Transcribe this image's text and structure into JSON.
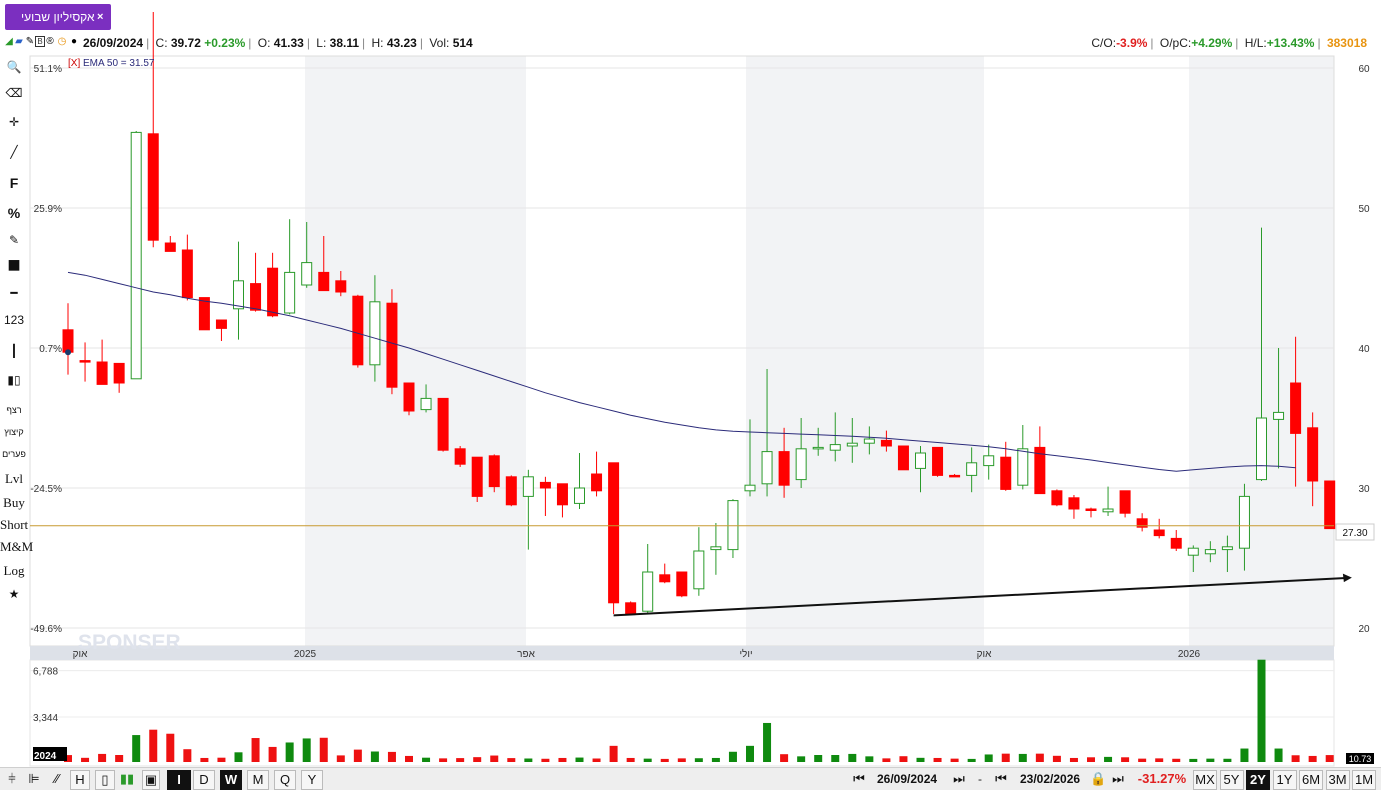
{
  "tab": {
    "title": "אקסיליון שבועי",
    "close": "×"
  },
  "info": {
    "date": "26/09/2024",
    "c_label": "C:",
    "c_value": "39.72",
    "c_change": "+0.23%",
    "o_label": "O:",
    "o_value": "41.33",
    "l_label": "L:",
    "l_value": "38.11",
    "h_label": "H:",
    "h_value": "43.23",
    "vol_label": "Vol:",
    "vol_value": "514",
    "co_label": "C/O:",
    "co_value": "-3.9%",
    "opc_label": "O/pC:",
    "opc_value": "+4.29%",
    "hl_label": "H/L:",
    "hl_value": "+13.43%",
    "symbol_id": "383018"
  },
  "toolbar_left": [
    {
      "name": "search-icon",
      "glyph": "🔍"
    },
    {
      "name": "eraser-icon",
      "glyph": "⌫"
    },
    {
      "name": "crosshair-icon",
      "glyph": "✛"
    },
    {
      "name": "line-tool-icon",
      "glyph": "╱"
    },
    {
      "name": "fibonacci-tool",
      "glyph": "F"
    },
    {
      "name": "percent-tool",
      "glyph": "%"
    },
    {
      "name": "pencil-icon",
      "glyph": "✎"
    },
    {
      "name": "color-swatch",
      "glyph": "■"
    },
    {
      "name": "line-width-icon",
      "glyph": "━"
    },
    {
      "name": "number-tool",
      "glyph": "123"
    },
    {
      "name": "vertical-line-icon",
      "glyph": "┃"
    },
    {
      "name": "candles-icon",
      "glyph": "▮▯"
    },
    {
      "name": "tool-range",
      "glyph": "רצף"
    },
    {
      "name": "tool-zoom",
      "glyph": "קיצוץ"
    },
    {
      "name": "tool-gaps",
      "glyph": "פערים"
    },
    {
      "name": "tool-lvl",
      "glyph": "Lvl"
    },
    {
      "name": "tool-buy",
      "glyph": "Buy"
    },
    {
      "name": "tool-short",
      "glyph": "Short"
    },
    {
      "name": "tool-mm",
      "glyph": "M&M"
    },
    {
      "name": "tool-log",
      "glyph": "Log"
    },
    {
      "name": "star-icon",
      "glyph": "★"
    }
  ],
  "bottom": {
    "periods": [
      "D",
      "W",
      "M",
      "Q",
      "Y"
    ],
    "active_period": "W",
    "start_date": "26/09/2024",
    "end_date": "23/02/2026",
    "dash": "-",
    "range_change": "-31.27%",
    "ranges": [
      "MX",
      "5Y",
      "2Y",
      "1Y",
      "6M",
      "3M",
      "1M"
    ],
    "active_range": "2Y",
    "year_label": "2024"
  },
  "colors": {
    "up": "#2a9a2a",
    "down": "#ff0000",
    "ema": "#2b2b7a",
    "hline": "#c79a30",
    "band": "#f2f3f5",
    "accent": "#7b2fc0"
  },
  "chart_data": {
    "type": "candlestick",
    "indicator_label": "EMA 50 = 31.57",
    "indicator_tag": "[X]",
    "y_axis_right": {
      "min": 20,
      "max": 60,
      "ticks": [
        20,
        30,
        40,
        50,
        60
      ]
    },
    "y_axis_left_pct": [
      "51.1%",
      "25.9%",
      "0.7%",
      "-24.5%",
      "-49.6%"
    ],
    "x_labels": [
      "אוק",
      "2025",
      "אפר",
      "יולי",
      "אוק",
      "2026"
    ],
    "current_price_label": "27.30",
    "current_price": 27.3,
    "volume_ticks": [
      "6,788",
      "3,344"
    ],
    "volume_right_label": "10.73",
    "volume_max": 7800,
    "candles": [
      {
        "o": 41.3,
        "h": 43.2,
        "l": 38.1,
        "c": 39.7,
        "v": 514
      },
      {
        "o": 39.1,
        "h": 40.4,
        "l": 37.6,
        "c": 39.0,
        "v": 310
      },
      {
        "o": 39.0,
        "h": 40.6,
        "l": 37.6,
        "c": 37.4,
        "v": 600
      },
      {
        "o": 38.9,
        "h": 38.9,
        "l": 36.8,
        "c": 37.5,
        "v": 520
      },
      {
        "o": 37.8,
        "h": 55.5,
        "l": 37.8,
        "c": 55.4,
        "v": 2000
      },
      {
        "o": 55.3,
        "h": 64.0,
        "l": 47.2,
        "c": 47.7,
        "v": 2400
      },
      {
        "o": 47.5,
        "h": 48.0,
        "l": 46.9,
        "c": 46.9,
        "v": 2100
      },
      {
        "o": 47.0,
        "h": 48.1,
        "l": 43.4,
        "c": 43.6,
        "v": 950
      },
      {
        "o": 43.6,
        "h": 43.6,
        "l": 41.3,
        "c": 41.3,
        "v": 300
      },
      {
        "o": 42.0,
        "h": 42.0,
        "l": 40.5,
        "c": 41.4,
        "v": 320
      },
      {
        "o": 42.8,
        "h": 47.6,
        "l": 40.6,
        "c": 44.8,
        "v": 720
      },
      {
        "o": 44.6,
        "h": 46.8,
        "l": 42.6,
        "c": 42.7,
        "v": 1780
      },
      {
        "o": 45.7,
        "h": 46.8,
        "l": 42.2,
        "c": 42.3,
        "v": 1120
      },
      {
        "o": 42.5,
        "h": 49.2,
        "l": 42.4,
        "c": 45.4,
        "v": 1450
      },
      {
        "o": 44.5,
        "h": 49.0,
        "l": 44.3,
        "c": 46.1,
        "v": 1750
      },
      {
        "o": 45.4,
        "h": 48.0,
        "l": 44.1,
        "c": 44.1,
        "v": 1800
      },
      {
        "o": 44.8,
        "h": 45.5,
        "l": 43.7,
        "c": 44.0,
        "v": 490
      },
      {
        "o": 43.7,
        "h": 43.8,
        "l": 38.6,
        "c": 38.8,
        "v": 920
      },
      {
        "o": 38.8,
        "h": 45.2,
        "l": 37.6,
        "c": 43.3,
        "v": 780
      },
      {
        "o": 43.2,
        "h": 44.2,
        "l": 36.7,
        "c": 37.2,
        "v": 750
      },
      {
        "o": 37.5,
        "h": 37.5,
        "l": 35.2,
        "c": 35.5,
        "v": 450
      },
      {
        "o": 35.6,
        "h": 37.4,
        "l": 35.4,
        "c": 36.4,
        "v": 320
      },
      {
        "o": 36.4,
        "h": 36.4,
        "l": 32.6,
        "c": 32.7,
        "v": 270
      },
      {
        "o": 32.8,
        "h": 33.0,
        "l": 31.5,
        "c": 31.7,
        "v": 290
      },
      {
        "o": 32.2,
        "h": 32.2,
        "l": 29.0,
        "c": 29.4,
        "v": 360
      },
      {
        "o": 32.3,
        "h": 32.4,
        "l": 29.7,
        "c": 30.1,
        "v": 480
      },
      {
        "o": 30.8,
        "h": 30.9,
        "l": 28.7,
        "c": 28.8,
        "v": 290
      },
      {
        "o": 29.4,
        "h": 31.3,
        "l": 25.6,
        "c": 30.8,
        "v": 260
      },
      {
        "o": 30.4,
        "h": 30.8,
        "l": 28.0,
        "c": 30.0,
        "v": 240
      },
      {
        "o": 30.3,
        "h": 30.3,
        "l": 27.9,
        "c": 28.8,
        "v": 300
      },
      {
        "o": 28.9,
        "h": 32.5,
        "l": 28.5,
        "c": 30.0,
        "v": 330
      },
      {
        "o": 31.0,
        "h": 32.6,
        "l": 29.4,
        "c": 29.8,
        "v": 260
      },
      {
        "o": 31.8,
        "h": 31.8,
        "l": 21.0,
        "c": 21.8,
        "v": 1200
      },
      {
        "o": 21.8,
        "h": 21.9,
        "l": 20.9,
        "c": 21.0,
        "v": 300
      },
      {
        "o": 21.2,
        "h": 26.0,
        "l": 21.0,
        "c": 24.0,
        "v": 250
      },
      {
        "o": 23.8,
        "h": 24.6,
        "l": 23.2,
        "c": 23.3,
        "v": 230
      },
      {
        "o": 24.0,
        "h": 23.6,
        "l": 22.2,
        "c": 22.3,
        "v": 270
      },
      {
        "o": 22.8,
        "h": 27.2,
        "l": 22.3,
        "c": 25.5,
        "v": 280
      },
      {
        "o": 25.6,
        "h": 27.5,
        "l": 23.8,
        "c": 25.8,
        "v": 300
      },
      {
        "o": 25.6,
        "h": 29.2,
        "l": 25.0,
        "c": 29.1,
        "v": 760
      },
      {
        "o": 29.8,
        "h": 34.9,
        "l": 29.4,
        "c": 30.2,
        "v": 1200
      },
      {
        "o": 30.3,
        "h": 38.5,
        "l": 29.4,
        "c": 32.6,
        "v": 2900
      },
      {
        "o": 32.6,
        "h": 34.3,
        "l": 29.3,
        "c": 30.2,
        "v": 580
      },
      {
        "o": 30.6,
        "h": 35.0,
        "l": 30.0,
        "c": 32.8,
        "v": 420
      },
      {
        "o": 32.8,
        "h": 34.3,
        "l": 32.3,
        "c": 32.9,
        "v": 520
      },
      {
        "o": 32.7,
        "h": 35.4,
        "l": 31.9,
        "c": 33.1,
        "v": 520
      },
      {
        "o": 33.0,
        "h": 35.0,
        "l": 31.8,
        "c": 33.2,
        "v": 600
      },
      {
        "o": 33.2,
        "h": 34.4,
        "l": 32.4,
        "c": 33.5,
        "v": 420
      },
      {
        "o": 33.4,
        "h": 34.1,
        "l": 32.6,
        "c": 33.0,
        "v": 270
      },
      {
        "o": 33.0,
        "h": 33.0,
        "l": 31.3,
        "c": 31.3,
        "v": 430
      },
      {
        "o": 31.4,
        "h": 33.0,
        "l": 29.7,
        "c": 32.5,
        "v": 310
      },
      {
        "o": 32.9,
        "h": 32.9,
        "l": 30.8,
        "c": 30.9,
        "v": 300
      },
      {
        "o": 30.9,
        "h": 31.0,
        "l": 30.8,
        "c": 30.8,
        "v": 250
      },
      {
        "o": 30.9,
        "h": 32.9,
        "l": 29.7,
        "c": 31.8,
        "v": 230
      },
      {
        "o": 31.6,
        "h": 33.1,
        "l": 30.6,
        "c": 32.3,
        "v": 560
      },
      {
        "o": 32.2,
        "h": 33.3,
        "l": 29.8,
        "c": 29.9,
        "v": 620
      },
      {
        "o": 30.2,
        "h": 34.5,
        "l": 29.9,
        "c": 32.8,
        "v": 600
      },
      {
        "o": 32.9,
        "h": 34.4,
        "l": 29.7,
        "c": 29.6,
        "v": 620
      },
      {
        "o": 29.8,
        "h": 29.9,
        "l": 28.7,
        "c": 28.8,
        "v": 460
      },
      {
        "o": 29.3,
        "h": 29.5,
        "l": 27.8,
        "c": 28.5,
        "v": 300
      },
      {
        "o": 28.5,
        "h": 28.6,
        "l": 27.9,
        "c": 28.4,
        "v": 350
      },
      {
        "o": 28.3,
        "h": 30.1,
        "l": 28.0,
        "c": 28.5,
        "v": 380
      },
      {
        "o": 29.8,
        "h": 29.8,
        "l": 27.9,
        "c": 28.2,
        "v": 350
      },
      {
        "o": 27.8,
        "h": 28.2,
        "l": 26.9,
        "c": 27.2,
        "v": 250
      },
      {
        "o": 27.0,
        "h": 27.8,
        "l": 26.4,
        "c": 26.6,
        "v": 270
      },
      {
        "o": 26.4,
        "h": 27.0,
        "l": 25.5,
        "c": 25.7,
        "v": 240
      },
      {
        "o": 25.2,
        "h": 25.9,
        "l": 24.0,
        "c": 25.7,
        "v": 230
      },
      {
        "o": 25.3,
        "h": 26.2,
        "l": 24.7,
        "c": 25.6,
        "v": 250
      },
      {
        "o": 25.6,
        "h": 26.6,
        "l": 24.0,
        "c": 25.8,
        "v": 240
      },
      {
        "o": 25.7,
        "h": 30.3,
        "l": 24.1,
        "c": 29.4,
        "v": 1000
      },
      {
        "o": 30.6,
        "h": 48.6,
        "l": 30.5,
        "c": 35.0,
        "v": 7600
      },
      {
        "o": 34.9,
        "h": 40.0,
        "l": 31.4,
        "c": 35.4,
        "v": 1000
      },
      {
        "o": 37.5,
        "h": 40.8,
        "l": 30.1,
        "c": 33.9,
        "v": 500
      },
      {
        "o": 34.3,
        "h": 35.4,
        "l": 28.7,
        "c": 30.5,
        "v": 450
      },
      {
        "o": 30.5,
        "h": 30.5,
        "l": 28.9,
        "c": 27.1,
        "v": 514
      }
    ],
    "ema50": [
      45.4,
      45.2,
      44.9,
      44.6,
      44.3,
      44.0,
      43.8,
      43.55,
      43.35,
      43.2,
      43.0,
      42.8,
      42.55,
      42.3,
      42.0,
      41.7,
      41.4,
      41.05,
      40.7,
      40.35,
      40.0,
      39.6,
      39.2,
      38.8,
      38.4,
      38.0,
      37.6,
      37.2,
      36.8,
      36.45,
      36.1,
      35.8,
      35.5,
      35.2,
      34.95,
      34.7,
      34.5,
      34.3,
      34.15,
      34.05,
      34.0,
      33.95,
      33.9,
      33.85,
      33.8,
      33.75,
      33.7,
      33.62,
      33.55,
      33.45,
      33.35,
      33.25,
      33.15,
      33.05,
      32.95,
      32.8,
      32.62,
      32.45,
      32.3,
      32.15,
      32.0,
      31.82,
      31.65,
      31.48,
      31.32,
      31.2,
      31.3,
      31.4,
      31.5,
      31.57,
      31.6,
      31.55,
      31.45
    ],
    "trendline": {
      "from": {
        "index": 32,
        "price": 20.9
      },
      "to": {
        "index": 75.3,
        "price": 23.6
      }
    }
  }
}
